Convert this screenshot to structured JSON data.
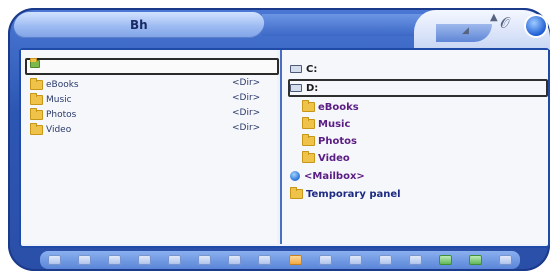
{
  "window": {
    "title": "Bh"
  },
  "left_pane": {
    "selected_row_label": "",
    "items": [
      {
        "name": "eBooks",
        "type": "<Dir>"
      },
      {
        "name": "Music",
        "type": "<Dir>"
      },
      {
        "name": "Photos",
        "type": "<Dir>"
      },
      {
        "name": "Video",
        "type": "<Dir>"
      }
    ]
  },
  "right_pane": {
    "drives": [
      {
        "label": "C:"
      },
      {
        "label": "D:"
      }
    ],
    "folders": [
      {
        "label": "eBooks"
      },
      {
        "label": "Music"
      },
      {
        "label": "Photos"
      },
      {
        "label": "Video"
      }
    ],
    "mailbox": "<Mailbox>",
    "temporary": "Temporary panel"
  },
  "toolbar": {
    "buttons": [
      {
        "icon": "tool-icon-1"
      },
      {
        "icon": "tool-icon-2"
      },
      {
        "icon": "tool-icon-3"
      },
      {
        "icon": "tool-icon-4"
      },
      {
        "icon": "tool-icon-5"
      },
      {
        "icon": "tool-icon-6"
      },
      {
        "icon": "tool-icon-7"
      },
      {
        "icon": "tool-icon-8"
      },
      {
        "icon": "tool-icon-9-orange"
      },
      {
        "icon": "tool-icon-10"
      },
      {
        "icon": "tool-icon-11"
      },
      {
        "icon": "tool-icon-12"
      },
      {
        "icon": "tool-icon-13"
      },
      {
        "icon": "tool-icon-14-green"
      },
      {
        "icon": "tool-icon-15-green"
      },
      {
        "icon": "tool-icon-16"
      }
    ]
  },
  "colors": {
    "window_blue": "#2d56b3",
    "pane_background": "#f6f7fb",
    "folder_yellow": "#efc34a",
    "item_text": "#1d2a83"
  }
}
